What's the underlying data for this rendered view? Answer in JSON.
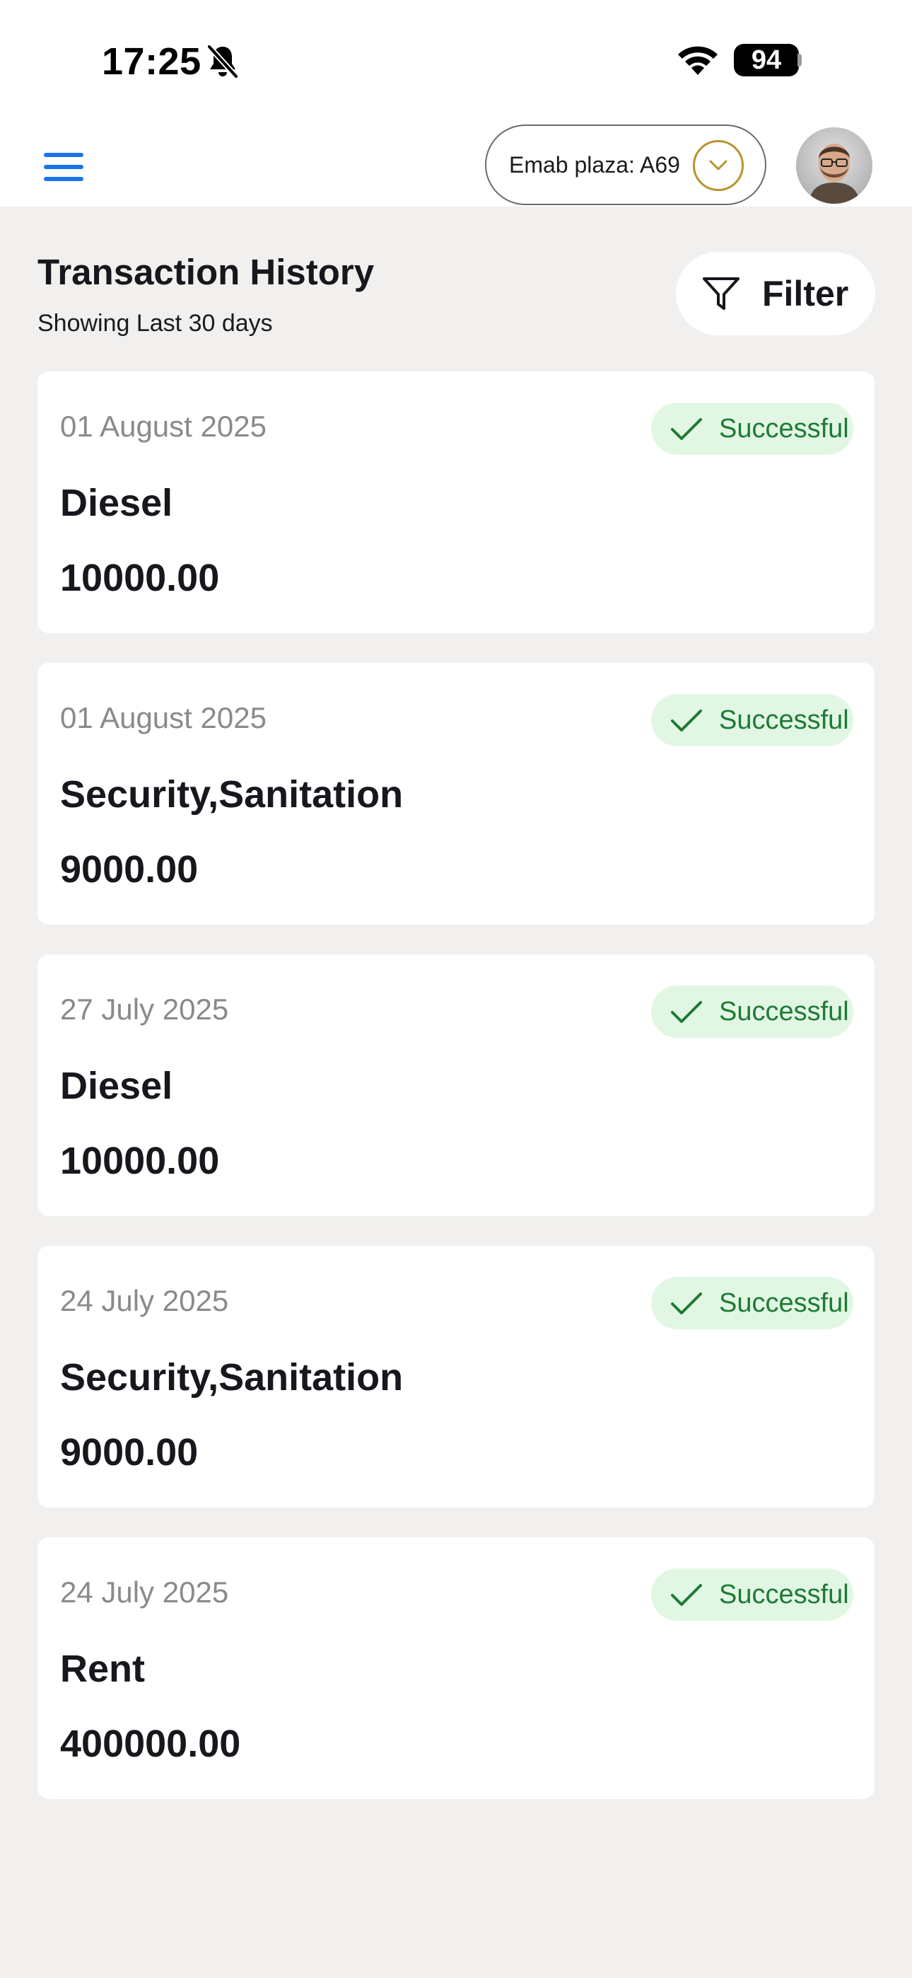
{
  "status_bar": {
    "time": "17:25",
    "battery": "94",
    "icons": [
      "bell-slash-icon",
      "wifi-icon",
      "battery-icon"
    ]
  },
  "header": {
    "menu_icon": "hamburger-menu-icon",
    "location": "Emab plaza: A69",
    "location_icon": "chevron-down-circle-icon",
    "avatar": "user-avatar",
    "accent_color": "#1a73e8",
    "location_accent": "#b8922c"
  },
  "page": {
    "title": "Transaction History",
    "subtitle": "Showing Last 30 days",
    "filter_label": "Filter",
    "filter_icon": "funnel-icon"
  },
  "transactions": [
    {
      "date": "01 August 2025",
      "status": "Successful",
      "category": "Diesel",
      "amount": "10000.00"
    },
    {
      "date": "01 August 2025",
      "status": "Successful",
      "category": "Security,Sanitation",
      "amount": "9000.00"
    },
    {
      "date": "27 July 2025",
      "status": "Successful",
      "category": "Diesel",
      "amount": "10000.00"
    },
    {
      "date": "24 July 2025",
      "status": "Successful",
      "category": "Security,Sanitation",
      "amount": "9000.00"
    },
    {
      "date": "24 July 2025",
      "status": "Successful",
      "category": "Rent",
      "amount": "400000.00"
    }
  ],
  "colors": {
    "background": "#f1f0ef",
    "success_bg": "#e1f7e4",
    "success_text": "#1f7a34"
  }
}
